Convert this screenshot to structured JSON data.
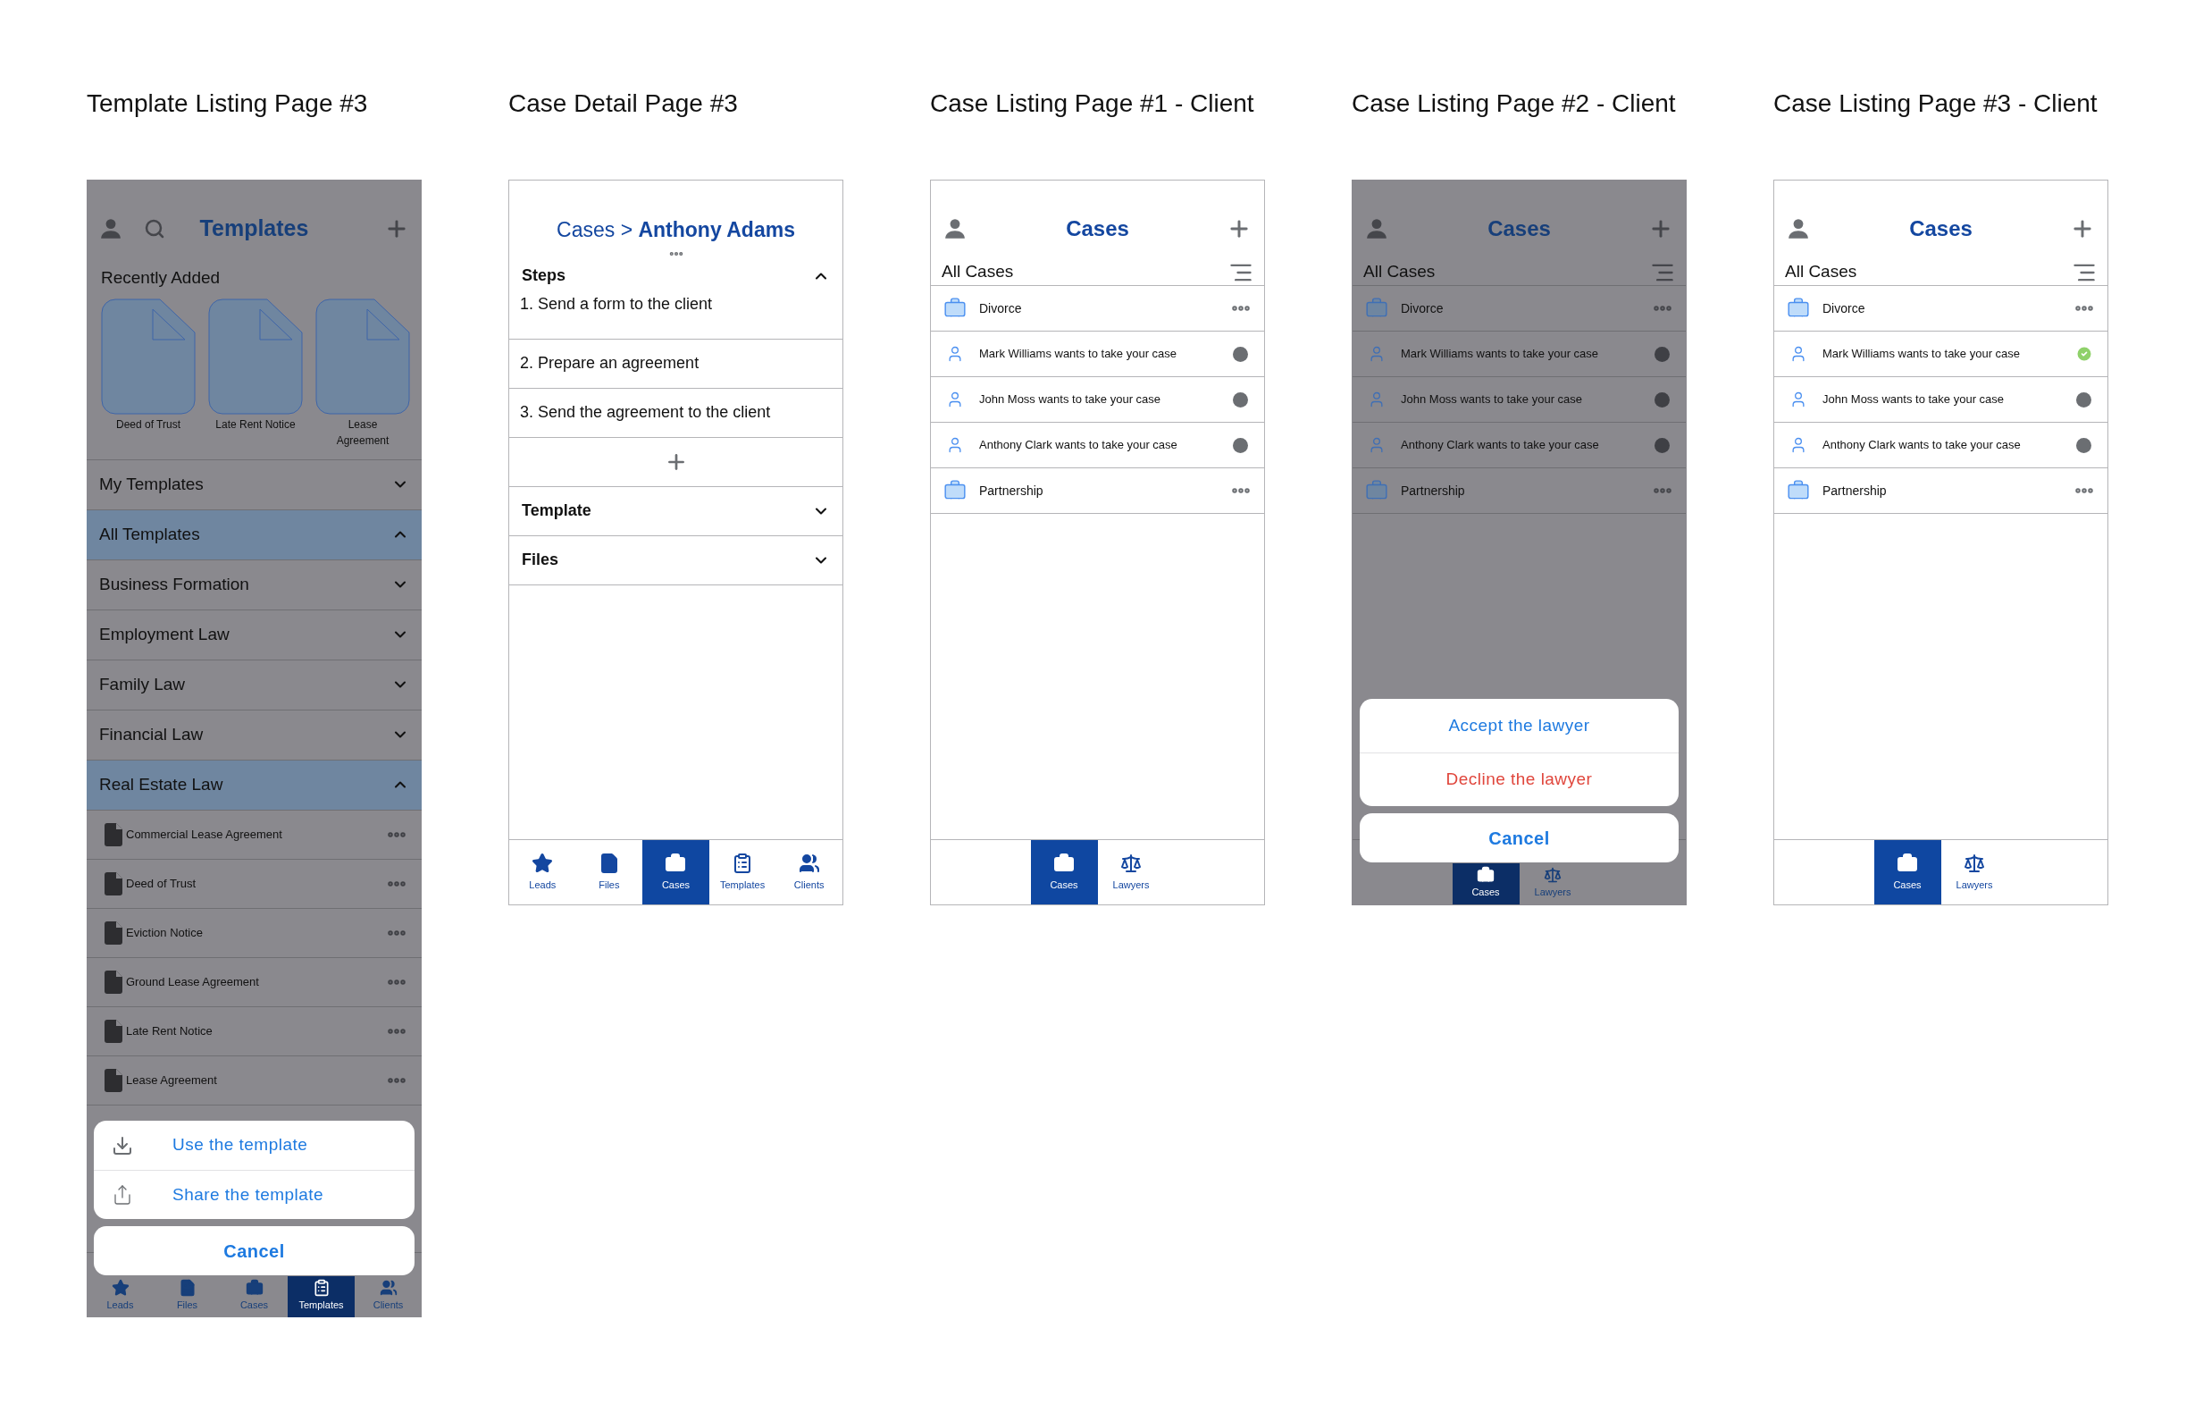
{
  "screens": [
    {
      "kind": "templates",
      "title": "Template Listing Page #3",
      "dimmed": true,
      "header": {
        "title": "Templates"
      },
      "recently_added": {
        "heading": "Recently Added",
        "items": [
          "Deed of Trust",
          "Late Rent Notice",
          "Lease Agreement"
        ]
      },
      "sections": [
        {
          "label": "My Templates",
          "expanded": false
        },
        {
          "label": "All Templates",
          "expanded": true,
          "children": [
            {
              "label": "Business Formation",
              "expanded": false
            },
            {
              "label": "Employment Law",
              "expanded": false
            },
            {
              "label": "Family Law",
              "expanded": false
            },
            {
              "label": "Financial Law",
              "expanded": false
            },
            {
              "label": "Real Estate Law",
              "expanded": true,
              "children": [
                {
                  "label": "Commercial Lease Agreement"
                },
                {
                  "label": "Deed of Trust"
                },
                {
                  "label": "Eviction Notice"
                },
                {
                  "label": "Ground Lease Agreement"
                },
                {
                  "label": "Late Rent Notice"
                },
                {
                  "label": "Lease Agreement"
                }
              ]
            }
          ]
        }
      ],
      "tabs": [
        {
          "label": "Leads",
          "kind": "leads",
          "selected": false
        },
        {
          "label": "Files",
          "kind": "files",
          "selected": false
        },
        {
          "label": "Cases",
          "kind": "cases",
          "selected": false
        },
        {
          "label": "Templates",
          "kind": "templates",
          "selected": true
        },
        {
          "label": "Clients",
          "kind": "clients",
          "selected": false
        }
      ],
      "action_sheet": {
        "actions": [
          {
            "label": "Use the template",
            "kind": "download"
          },
          {
            "label": "Share the template",
            "kind": "share"
          }
        ],
        "cancel": "Cancel"
      }
    },
    {
      "kind": "case_detail",
      "title": "Case Detail Page #3",
      "dimmed": false,
      "breadcrumb": "Cases > **Anthony Adams**",
      "steps": {
        "label": "Steps",
        "expanded": true,
        "items": [
          "1. Send a form to the client",
          "2. Prepare an agreement",
          "3. Send the agreement to the client"
        ]
      },
      "panels": [
        {
          "label": "Template",
          "expanded": false
        },
        {
          "label": "Files",
          "expanded": false
        }
      ],
      "tabs": [
        {
          "label": "Leads",
          "kind": "leads",
          "selected": false
        },
        {
          "label": "Files",
          "kind": "files",
          "selected": false
        },
        {
          "label": "Cases",
          "kind": "cases",
          "selected": true
        },
        {
          "label": "Templates",
          "kind": "templates",
          "selected": false
        },
        {
          "label": "Clients",
          "kind": "clients",
          "selected": false
        }
      ]
    },
    {
      "kind": "case_listing",
      "title": "Case Listing Page #1 - Client",
      "dimmed": false,
      "header": {
        "title": "Cases"
      },
      "filter_label": "All Cases",
      "rows": [
        {
          "kind": "case",
          "label": "Divorce"
        },
        {
          "kind": "request",
          "label": "Mark Williams wants to take your case",
          "accepted": false
        },
        {
          "kind": "request",
          "label": "John Moss wants to take your case",
          "accepted": false
        },
        {
          "kind": "request",
          "label": "Anthony Clark wants to take your case",
          "accepted": false
        },
        {
          "kind": "case",
          "label": "Partnership"
        }
      ],
      "tabs": [
        {
          "label": "Cases",
          "kind": "cases",
          "selected": true
        },
        {
          "label": "Lawyers",
          "kind": "lawyers",
          "selected": false
        }
      ]
    },
    {
      "kind": "case_listing",
      "title": "Case Listing Page #2 - Client",
      "dimmed": true,
      "header": {
        "title": "Cases"
      },
      "filter_label": "All Cases",
      "rows": [
        {
          "kind": "case",
          "label": "Divorce"
        },
        {
          "kind": "request",
          "label": "Mark Williams wants to take your case",
          "accepted": false
        },
        {
          "kind": "request",
          "label": "John Moss wants to take your case",
          "accepted": false
        },
        {
          "kind": "request",
          "label": "Anthony Clark wants to take your case",
          "accepted": false
        },
        {
          "kind": "case",
          "label": "Partnership"
        }
      ],
      "tabs": [
        {
          "label": "Cases",
          "kind": "cases",
          "selected": true
        },
        {
          "label": "Lawyers",
          "kind": "lawyers",
          "selected": false
        }
      ],
      "action_sheet": {
        "actions": [
          {
            "label": "Accept the lawyer",
            "kind": "confirm"
          },
          {
            "label": "Decline the lawyer",
            "kind": "destructive"
          }
        ],
        "cancel": "Cancel"
      }
    },
    {
      "kind": "case_listing",
      "title": "Case Listing Page #3 - Client",
      "dimmed": false,
      "header": {
        "title": "Cases"
      },
      "filter_label": "All Cases",
      "rows": [
        {
          "kind": "case",
          "label": "Divorce"
        },
        {
          "kind": "request",
          "label": "Mark Williams wants to take your case",
          "accepted": true
        },
        {
          "kind": "request",
          "label": "John Moss wants to take your case",
          "accepted": false
        },
        {
          "kind": "request",
          "label": "Anthony Clark wants to take your case",
          "accepted": false
        },
        {
          "kind": "case",
          "label": "Partnership"
        }
      ],
      "tabs": [
        {
          "label": "Cases",
          "kind": "cases",
          "selected": true
        },
        {
          "label": "Lawyers",
          "kind": "lawyers",
          "selected": false
        }
      ]
    }
  ]
}
